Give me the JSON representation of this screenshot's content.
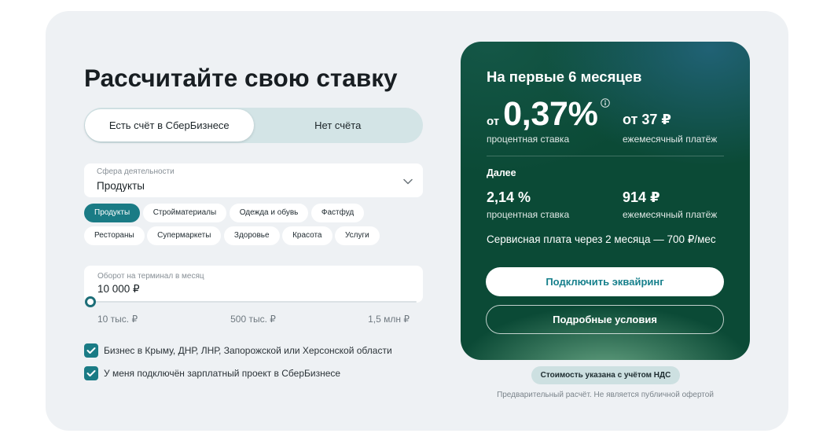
{
  "title": "Рассчитайте свою ставку",
  "account_toggle": {
    "options": [
      "Есть счёт в СберБизнесе",
      "Нет счёта"
    ],
    "selected_index": 0
  },
  "activity": {
    "label": "Сфера деятельности",
    "value": "Продукты",
    "chips": [
      "Продукты",
      "Стройматериалы",
      "Одежда и обувь",
      "Фастфуд",
      "Рестораны",
      "Супермаркеты",
      "Здоровье",
      "Красота",
      "Услуги"
    ],
    "selected_chip_index": 0
  },
  "turnover": {
    "label": "Оборот на терминал в месяц",
    "value": "10 000 ₽",
    "slider_level": 0,
    "scale": [
      "10 тыс. ₽",
      "500 тыс. ₽",
      "1,5 млн ₽"
    ]
  },
  "checkboxes": [
    {
      "label": "Бизнес в Крыму, ДНР, ЛНР, Запорожской или Херсонской области",
      "checked": true
    },
    {
      "label": "У меня подключён зарплатный проект в СберБизнесе",
      "checked": true
    }
  ],
  "result": {
    "heading": "На первые 6 месяцев",
    "first_period": {
      "rate_prefix": "от",
      "rate": "0,37%",
      "rate_caption": "процентная ставка",
      "payment": "от 37 ₽",
      "payment_caption": "ежемесячный платёж"
    },
    "later_heading": "Далее",
    "later_period": {
      "rate": "2,14 %",
      "rate_caption": "процентная ставка",
      "payment": "914 ₽",
      "payment_caption": "ежемесячный платёж"
    },
    "service_fee": "Сервисная плата через 2 месяца — 700 ₽/мес",
    "primary_button": "Подключить эквайринг",
    "secondary_button": "Подробные условия"
  },
  "vat_badge": "Стоимость указана с учётом НДС",
  "disclaimer": "Предварительный расчёт. Не является публичной офертой",
  "icons": {
    "activity_dropdown": "chevron-down-icon",
    "rate_info": "info-icon",
    "checkbox_mark": "check-icon"
  },
  "colors": {
    "accent": "#1a7b85",
    "result_card": "#0b4a36",
    "toggle_bg": "#d3e4e6",
    "panel_bg": "#eef1f4",
    "badge_bg": "#cde0e1",
    "primary_button_text": "#17808c"
  }
}
